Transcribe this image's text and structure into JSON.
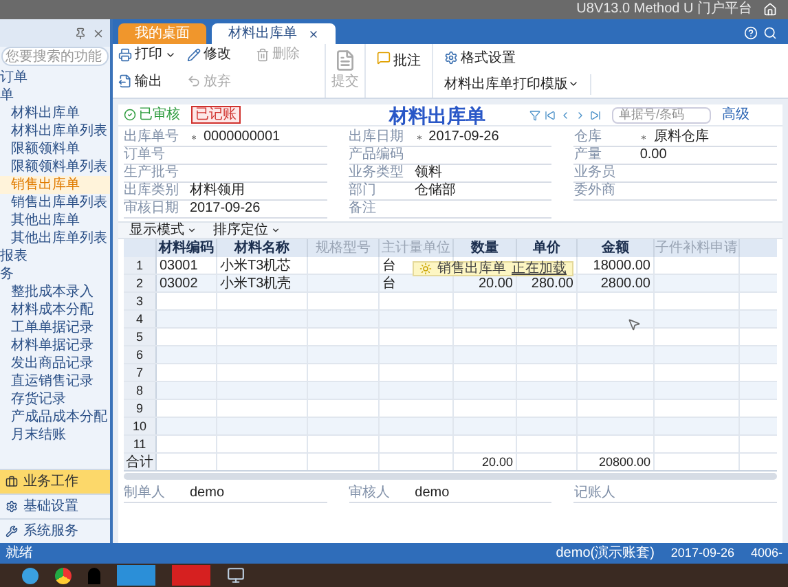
{
  "window": {
    "title": "U8V13.0 Method U 门户平台"
  },
  "tabs": [
    {
      "label": "我的桌面",
      "selected": false,
      "closable": false
    },
    {
      "label": "材料出库单",
      "selected": true,
      "closable": true
    }
  ],
  "sidebar": {
    "search": {
      "placeholder": "您要搜索的功能"
    },
    "items": [
      {
        "label": "订单",
        "kind": "group",
        "selected": false
      },
      {
        "label": "单",
        "kind": "group",
        "selected": false
      },
      {
        "label": "材料出库单",
        "kind": "item",
        "selected": false
      },
      {
        "label": "材料出库单列表",
        "kind": "item",
        "selected": false
      },
      {
        "label": "限额领料单",
        "kind": "item",
        "selected": false
      },
      {
        "label": "限额领料单列表",
        "kind": "item",
        "selected": false
      },
      {
        "label": "销售出库单",
        "kind": "item",
        "selected": true
      },
      {
        "label": "销售出库单列表",
        "kind": "item",
        "selected": false
      },
      {
        "label": "其他出库单",
        "kind": "item",
        "selected": false
      },
      {
        "label": "其他出库单列表",
        "kind": "item",
        "selected": false
      },
      {
        "label": "报表",
        "kind": "group",
        "selected": false
      },
      {
        "label": "务",
        "kind": "group",
        "selected": false
      },
      {
        "label": "整批成本录入",
        "kind": "item",
        "selected": false
      },
      {
        "label": "材料成本分配",
        "kind": "item",
        "selected": false
      },
      {
        "label": "工单单据记录",
        "kind": "item",
        "selected": false
      },
      {
        "label": "材料单据记录",
        "kind": "item",
        "selected": false
      },
      {
        "label": "发出商品记录",
        "kind": "item",
        "selected": false
      },
      {
        "label": "直运销售记录",
        "kind": "item",
        "selected": false
      },
      {
        "label": "存货记录",
        "kind": "item",
        "selected": false
      },
      {
        "label": "产成品成本分配",
        "kind": "item",
        "selected": false
      },
      {
        "label": "月末结账",
        "kind": "item",
        "selected": false
      }
    ],
    "sections": [
      {
        "label": "业务工作",
        "selected": true
      },
      {
        "label": "基础设置",
        "selected": false
      },
      {
        "label": "系统服务",
        "selected": false
      }
    ]
  },
  "toolbar": {
    "buttons": [
      {
        "label": "打印",
        "disabled": false,
        "dropdown": true
      },
      {
        "label": "修改",
        "disabled": false,
        "dropdown": false
      },
      {
        "label": "删除",
        "disabled": true,
        "dropdown": false
      },
      {
        "label": "输出",
        "disabled": false,
        "dropdown": false
      },
      {
        "label": "放弃",
        "disabled": true,
        "dropdown": false
      }
    ],
    "large_button": {
      "label": "提交",
      "disabled": true
    },
    "format": {
      "label": "格式设置"
    },
    "approve": {
      "label": "批注"
    },
    "template": {
      "value": "材料出库单打印模版"
    }
  },
  "document": {
    "status": "已审核",
    "stamp": "已记账",
    "title": "材料出库单",
    "search": {
      "placeholder": "单据号/条码"
    },
    "advanced": "高级",
    "fields": [
      [
        {
          "label": "出库单号",
          "required": true,
          "value": "0000000001"
        },
        {
          "label": "订单号",
          "required": false
        },
        {
          "label": "生产批号",
          "required": false
        },
        {
          "label": "出库类别",
          "required": false,
          "value": "材料领用"
        },
        {
          "label": "审核日期",
          "required": false,
          "value": "2017-09-26"
        }
      ],
      [
        {
          "label": "出库日期",
          "required": true,
          "value": "2017-09-26"
        },
        {
          "label": "产品编码",
          "required": false
        },
        {
          "label": "业务类型",
          "required": false,
          "value": "领料"
        },
        {
          "label": "部门",
          "required": false,
          "value": "仓储部"
        },
        {
          "label": "备注",
          "required": false
        }
      ],
      [
        {
          "label": "仓库",
          "required": true,
          "value": "原料仓库"
        },
        {
          "label": "产量",
          "required": false,
          "value": "0.00"
        },
        {
          "label": "业务员",
          "required": false
        },
        {
          "label": "委外商",
          "required": false
        }
      ]
    ]
  },
  "table": {
    "view_menus": [
      "显示模式",
      "排序定位"
    ],
    "columns": [
      {
        "label": "材料编码",
        "editable": true
      },
      {
        "label": "材料名称",
        "editable": true
      },
      {
        "label": "规格型号",
        "editable": false
      },
      {
        "label": "主计量单位",
        "editable": false
      },
      {
        "label": "数量",
        "editable": true
      },
      {
        "label": "单价",
        "editable": true
      },
      {
        "label": "金额",
        "editable": true
      },
      {
        "label": "子件补料申请",
        "editable": false
      }
    ],
    "rows": [
      {
        "number": "1",
        "cells": [
          "03001",
          "小米T3机芯",
          null,
          "台",
          null,
          null,
          "18000.00",
          null
        ]
      },
      {
        "number": "2",
        "cells": [
          "03002",
          "小米T3机壳",
          null,
          "台",
          "20.00",
          "280.00",
          "2800.00",
          null
        ]
      },
      {
        "number": "3",
        "cells": []
      },
      {
        "number": "4",
        "cells": []
      },
      {
        "number": "5",
        "cells": []
      },
      {
        "number": "6",
        "cells": []
      },
      {
        "number": "7",
        "cells": []
      },
      {
        "number": "8",
        "cells": []
      },
      {
        "number": "9",
        "cells": []
      },
      {
        "number": "10",
        "cells": []
      },
      {
        "number": "11",
        "cells": []
      }
    ],
    "total": {
      "label": "合计",
      "cells": [
        null,
        null,
        null,
        null,
        "20.00",
        null,
        "20800.00",
        null
      ]
    },
    "tooltip": {
      "text": "销售出库单",
      "link": "正在加载"
    }
  },
  "footer": [
    {
      "label": "制单人",
      "value": "demo"
    },
    {
      "label": "审核人",
      "value": "demo"
    },
    {
      "label": "记账人"
    }
  ],
  "status_bar": {
    "message": "就绪",
    "user": "demo(演示账套)",
    "date": "2017-09-26",
    "phone": "4006-"
  }
}
